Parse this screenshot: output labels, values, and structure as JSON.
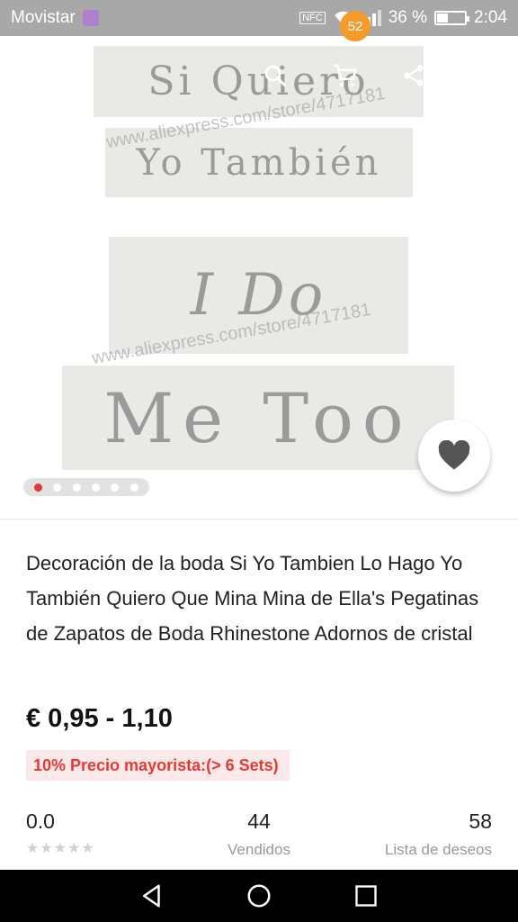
{
  "status_bar": {
    "carrier": "Movistar",
    "nfc": "NFC",
    "battery_percent": "36 %",
    "battery_level": 0.36,
    "time": "2:04"
  },
  "toolbar": {
    "cart_count": "52"
  },
  "gallery": {
    "stickers": [
      "Si Quiero",
      "Yo También",
      "I Do",
      "Me Too"
    ],
    "watermarks": [
      "www.aliexpress.com/store/4717181",
      "www.aliexpress.com/store/4717181"
    ],
    "total_images": 6,
    "active_index": 0
  },
  "product": {
    "title": "Decoración de la boda Si Yo Tambien Lo Hago Yo También Quiero Que Mina Mina de Ella's Pegatinas de Zapatos de Boda Rhinestone Adornos de cristal",
    "price": "€ 0,95 - 1,10",
    "wholesale": "10% Precio mayorista:(> 6 Sets)"
  },
  "stats": {
    "rating": "0.0",
    "stars": "★★★★★",
    "sold_count": "44",
    "sold_label": "Vendidos",
    "wishlist_count": "58",
    "wishlist_label": "Lista de deseos"
  },
  "colors": {
    "accent_red": "#e53935",
    "badge_orange": "#f59b2a",
    "status_bar": "#a8a8a8"
  },
  "icons": [
    "back-arrow-icon",
    "search-icon",
    "cart-icon",
    "share-icon",
    "more-vertical-icon",
    "heart-icon",
    "nav-back-icon",
    "nav-home-icon",
    "nav-recents-icon"
  ]
}
